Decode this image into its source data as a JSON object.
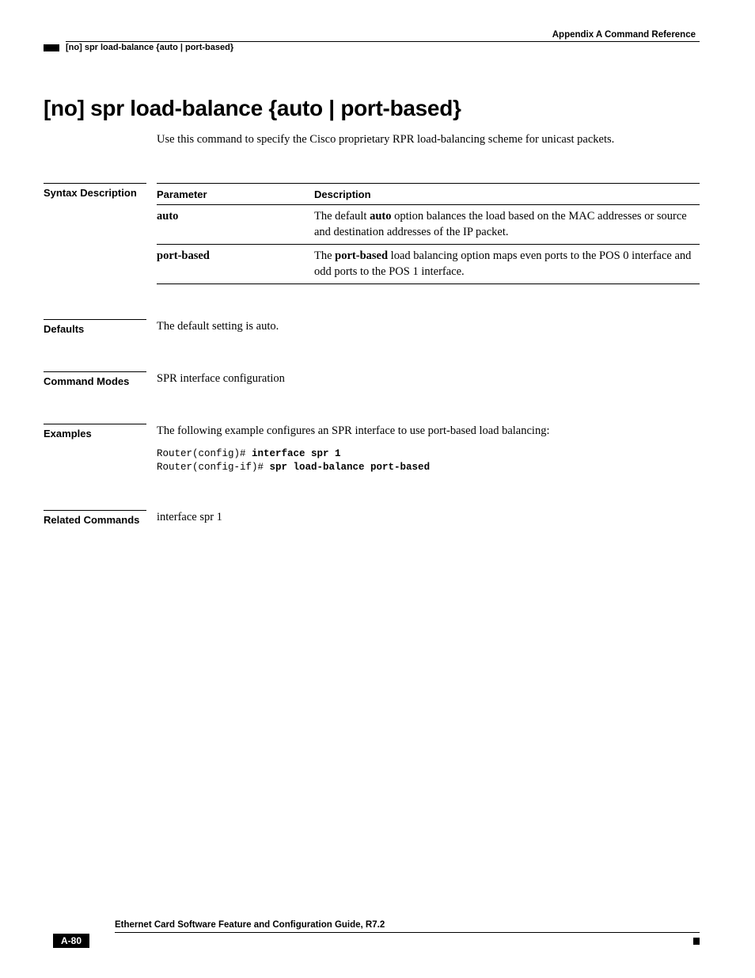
{
  "header": {
    "appendix": "Appendix A      Command Reference",
    "command_short": "[no] spr load-balance {auto | port-based}"
  },
  "title": "[no] spr load-balance {auto | port-based}",
  "intro": "Use this command to specify the Cisco proprietary RPR load-balancing scheme for unicast packets.",
  "syntax": {
    "label": "Syntax Description",
    "col_param": "Parameter",
    "col_desc": "Description",
    "rows": [
      {
        "param": "auto",
        "desc_pre": "The default ",
        "desc_bold": "auto",
        "desc_post": " option balances the load based on the MAC addresses or source and destination addresses of the IP packet."
      },
      {
        "param": "port-based",
        "desc_pre": "The ",
        "desc_bold": "port-based",
        "desc_post": " load balancing option maps even ports to the POS 0 interface and odd ports to the POS 1 interface."
      }
    ]
  },
  "defaults": {
    "label": "Defaults",
    "text": "The default setting is auto."
  },
  "modes": {
    "label": "Command Modes",
    "text": "SPR interface configuration"
  },
  "examples": {
    "label": "Examples",
    "text": "The following example configures an SPR interface to use port-based load balancing:",
    "code_line1_plain": "Router(config)# ",
    "code_line1_bold": "interface spr 1",
    "code_line2_plain": "Router(config-if)# ",
    "code_line2_bold": "spr load-balance port-based"
  },
  "related": {
    "label": "Related Commands",
    "text": "interface spr 1"
  },
  "footer": {
    "title": "Ethernet Card Software Feature and Configuration Guide, R7.2",
    "page": "A-80"
  }
}
